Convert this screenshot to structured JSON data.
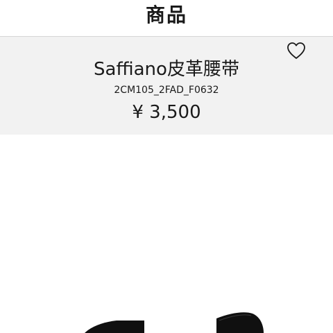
{
  "nav": {
    "title": "商品"
  },
  "product": {
    "name": "Saffiano皮革腰带",
    "sku": "2CM105_2FAD_F0632",
    "price": "¥ 3,500"
  },
  "icons": {
    "favorite": "heart-outline-icon"
  },
  "colors": {
    "header_background": "#f2f2f2",
    "text": "#1a1a1a",
    "belt": "#0f0f0f"
  }
}
